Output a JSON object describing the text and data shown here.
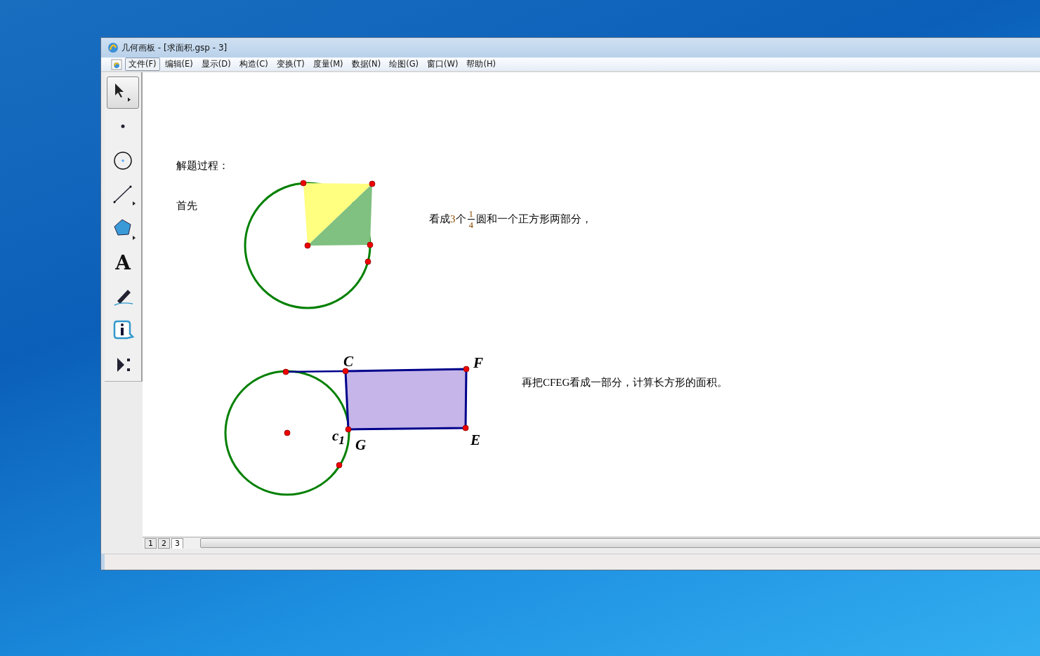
{
  "window": {
    "title": "几何画板 - [求面积.gsp - 3]"
  },
  "menu": [
    {
      "label": "文件(F)",
      "selected": true
    },
    {
      "label": "编辑(E)",
      "selected": false
    },
    {
      "label": "显示(D)",
      "selected": false
    },
    {
      "label": "构造(C)",
      "selected": false
    },
    {
      "label": "变换(T)",
      "selected": false
    },
    {
      "label": "度量(M)",
      "selected": false
    },
    {
      "label": "数据(N)",
      "selected": false
    },
    {
      "label": "绘图(G)",
      "selected": false
    },
    {
      "label": "窗口(W)",
      "selected": false
    },
    {
      "label": "帮助(H)",
      "selected": false
    }
  ],
  "tools": [
    {
      "kind": "arrow",
      "selected": true
    },
    {
      "kind": "point",
      "selected": false
    },
    {
      "kind": "compass",
      "selected": false
    },
    {
      "kind": "line",
      "selected": false
    },
    {
      "kind": "polygon",
      "selected": false
    },
    {
      "kind": "text",
      "glyph": "A",
      "selected": false
    },
    {
      "kind": "marker",
      "selected": false
    },
    {
      "kind": "info",
      "selected": false
    },
    {
      "kind": "custom",
      "selected": false
    }
  ],
  "canvas": {
    "heading": "解题过程：",
    "step": "首先",
    "sentence_1": {
      "before": "看成",
      "number": "3",
      "after_number": "个",
      "numerator": "1",
      "denominator": "4",
      "after": "圆和一个正方形两部分，"
    },
    "sentence_2": "再把CFEG看成一部分，计算长方形的面积。",
    "labels": [
      {
        "text": "C"
      },
      {
        "text": "F"
      },
      {
        "text": "c$_{1}$"
      },
      {
        "text": "G"
      },
      {
        "text": "E"
      }
    ]
  },
  "page_tabs": [
    {
      "label": "1",
      "selected": false
    },
    {
      "label": "2",
      "selected": false
    },
    {
      "label": "3",
      "selected": true
    }
  ]
}
